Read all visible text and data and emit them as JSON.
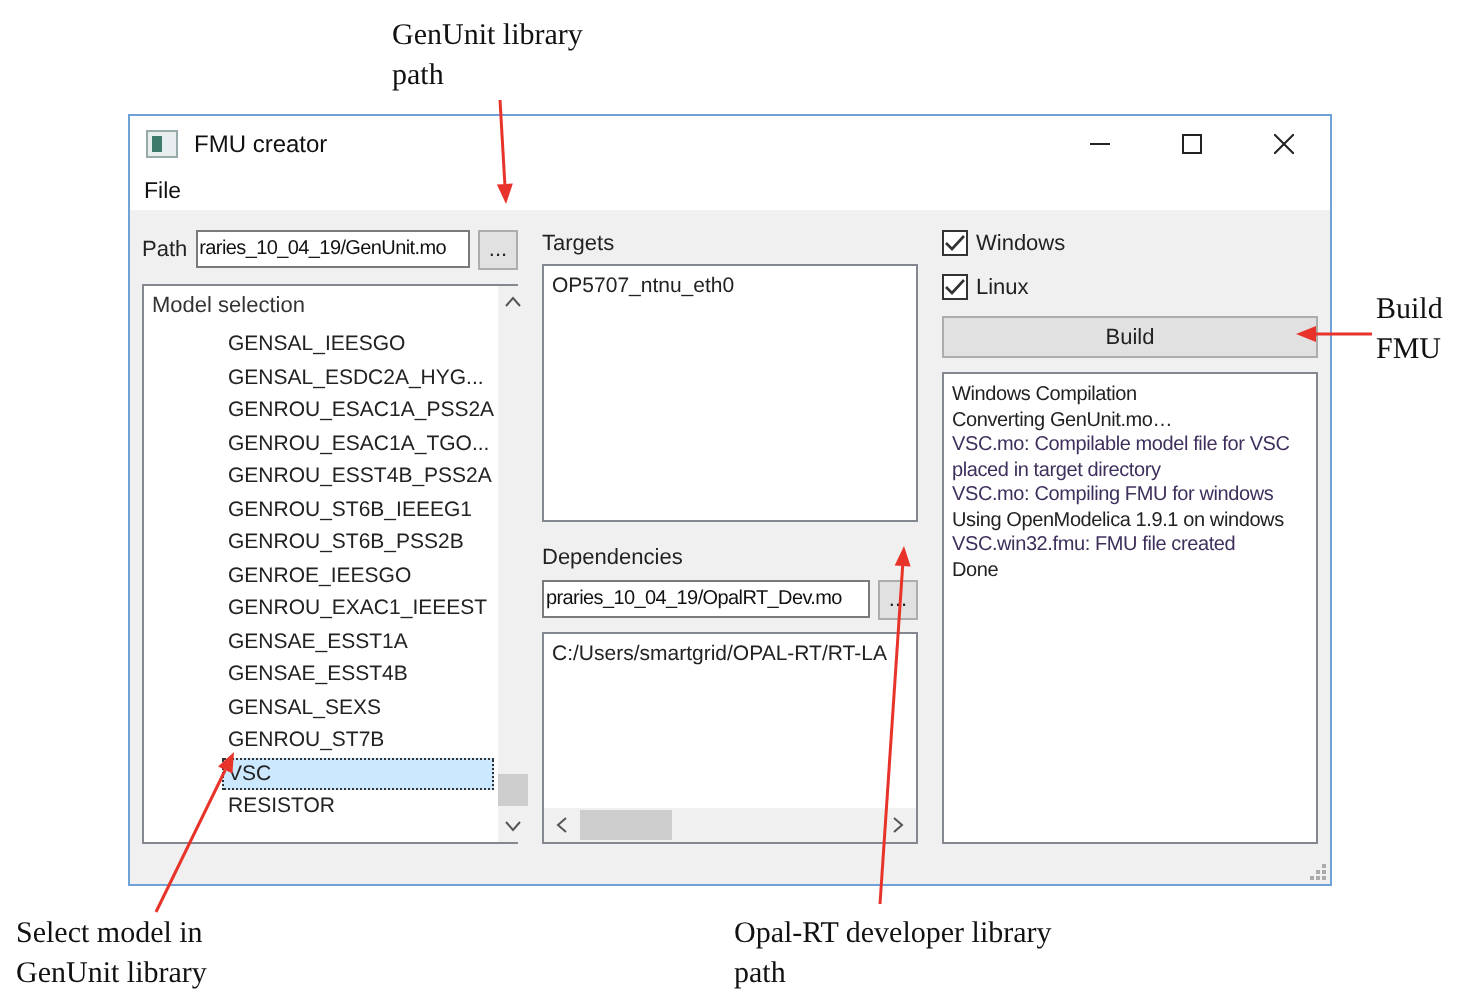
{
  "window": {
    "title": "FMU creator"
  },
  "menu": [
    "File"
  ],
  "path": {
    "label": "Path",
    "value": "raries_10_04_19/GenUnit.mo",
    "button": "..."
  },
  "model_selection": {
    "heading": "Model selection",
    "items": [
      {
        "label": "GENSAL_IEESGO",
        "selected": false
      },
      {
        "label": "GENSAL_ESDC2A_HYG...",
        "selected": false
      },
      {
        "label": "GENROU_ESAC1A_PSS2A",
        "selected": false
      },
      {
        "label": "GENROU_ESAC1A_TGO...",
        "selected": false
      },
      {
        "label": "GENROU_ESST4B_PSS2A",
        "selected": false
      },
      {
        "label": "GENROU_ST6B_IEEEG1",
        "selected": false
      },
      {
        "label": "GENROU_ST6B_PSS2B",
        "selected": false
      },
      {
        "label": "GENROE_IEESGO",
        "selected": false
      },
      {
        "label": "GENROU_EXAC1_IEEEST",
        "selected": false
      },
      {
        "label": "GENSAE_ESST1A",
        "selected": false
      },
      {
        "label": "GENSAE_ESST4B",
        "selected": false
      },
      {
        "label": "GENSAL_SEXS",
        "selected": false
      },
      {
        "label": "GENROU_ST7B",
        "selected": false
      },
      {
        "label": "VSC",
        "selected": true
      },
      {
        "label": "RESISTOR",
        "selected": false
      }
    ]
  },
  "targets": {
    "label": "Targets",
    "items": [
      "OP5707_ntnu_eth0"
    ]
  },
  "dependencies": {
    "label": "Dependencies",
    "value": "praries_10_04_19/OpalRT_Dev.mo",
    "button": "...",
    "items": [
      "C:/Users/smartgrid/OPAL-RT/RT-LA"
    ]
  },
  "platforms": [
    {
      "label": "Windows",
      "checked": true
    },
    {
      "label": "Linux",
      "checked": true
    }
  ],
  "build_button": "Build",
  "log": [
    {
      "text": "Windows Compilation",
      "color": "#222222"
    },
    {
      "text": "Converting GenUnit.mo…",
      "color": "#222222"
    },
    {
      "text": "VSC.mo: Compilable model file for VSC placed in target directory",
      "color": "#3f2f5c"
    },
    {
      "text": "VSC.mo: Compiling FMU for windows",
      "color": "#3f2f5c"
    },
    {
      "text": "Using OpenModelica 1.9.1 on windows",
      "color": "#222222"
    },
    {
      "text": "VSC.win32.fmu: FMU file created",
      "color": "#3f2f5c"
    },
    {
      "text": "Done",
      "color": "#222222"
    }
  ],
  "annotations": [
    {
      "text": "GenUnit library path"
    },
    {
      "text": "Build FMU"
    },
    {
      "text": "Select model in GenUnit library"
    },
    {
      "text": "Opal-RT developer library path"
    }
  ]
}
